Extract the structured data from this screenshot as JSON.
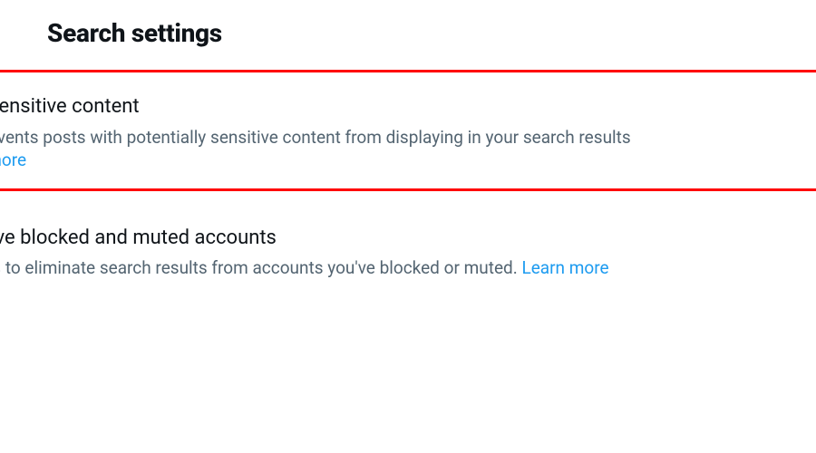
{
  "header": {
    "title": "Search settings"
  },
  "settings": {
    "sensitive": {
      "title": "e sensitive content",
      "description": " prevents posts with potentially sensitive content from displaying in your search results",
      "learn_more": "n more"
    },
    "blocked": {
      "title": "nove blocked and muted accounts",
      "description": " this to eliminate search results from accounts you've blocked or muted. ",
      "learn_more": "Learn more"
    }
  }
}
